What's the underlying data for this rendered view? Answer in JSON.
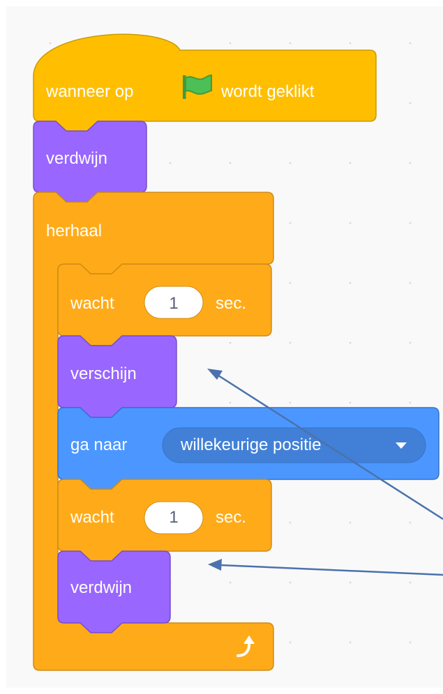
{
  "script": {
    "hat": {
      "before_flag": "wanneer op",
      "flag_icon": "green-flag-icon",
      "after_flag": "wordt geklikt"
    },
    "hide_1": {
      "label": "verdwijn"
    },
    "repeat": {
      "label": "herhaal",
      "loop_icon": "loop-arrow-icon"
    },
    "wait_1": {
      "label": "wacht",
      "value": "1",
      "unit": "sec."
    },
    "show": {
      "label": "verschijn"
    },
    "goto": {
      "label": "ga naar",
      "target": "willekeurige positie",
      "dropdown_icon": "dropdown-arrow-icon"
    },
    "wait_2": {
      "label": "wacht",
      "value": "1",
      "unit": "sec."
    },
    "hide_2": {
      "label": "verdwijn"
    }
  },
  "colors": {
    "events": "#ffbf00",
    "events_border": "#cc9900",
    "looks": "#9966ff",
    "looks_border": "#774dcb",
    "control": "#ffab19",
    "control_border": "#cf8b17",
    "motion": "#4c97ff",
    "motion_border": "#3373cc",
    "motion_dropdown": "#4280d7",
    "arrow": "#4a72ad"
  }
}
